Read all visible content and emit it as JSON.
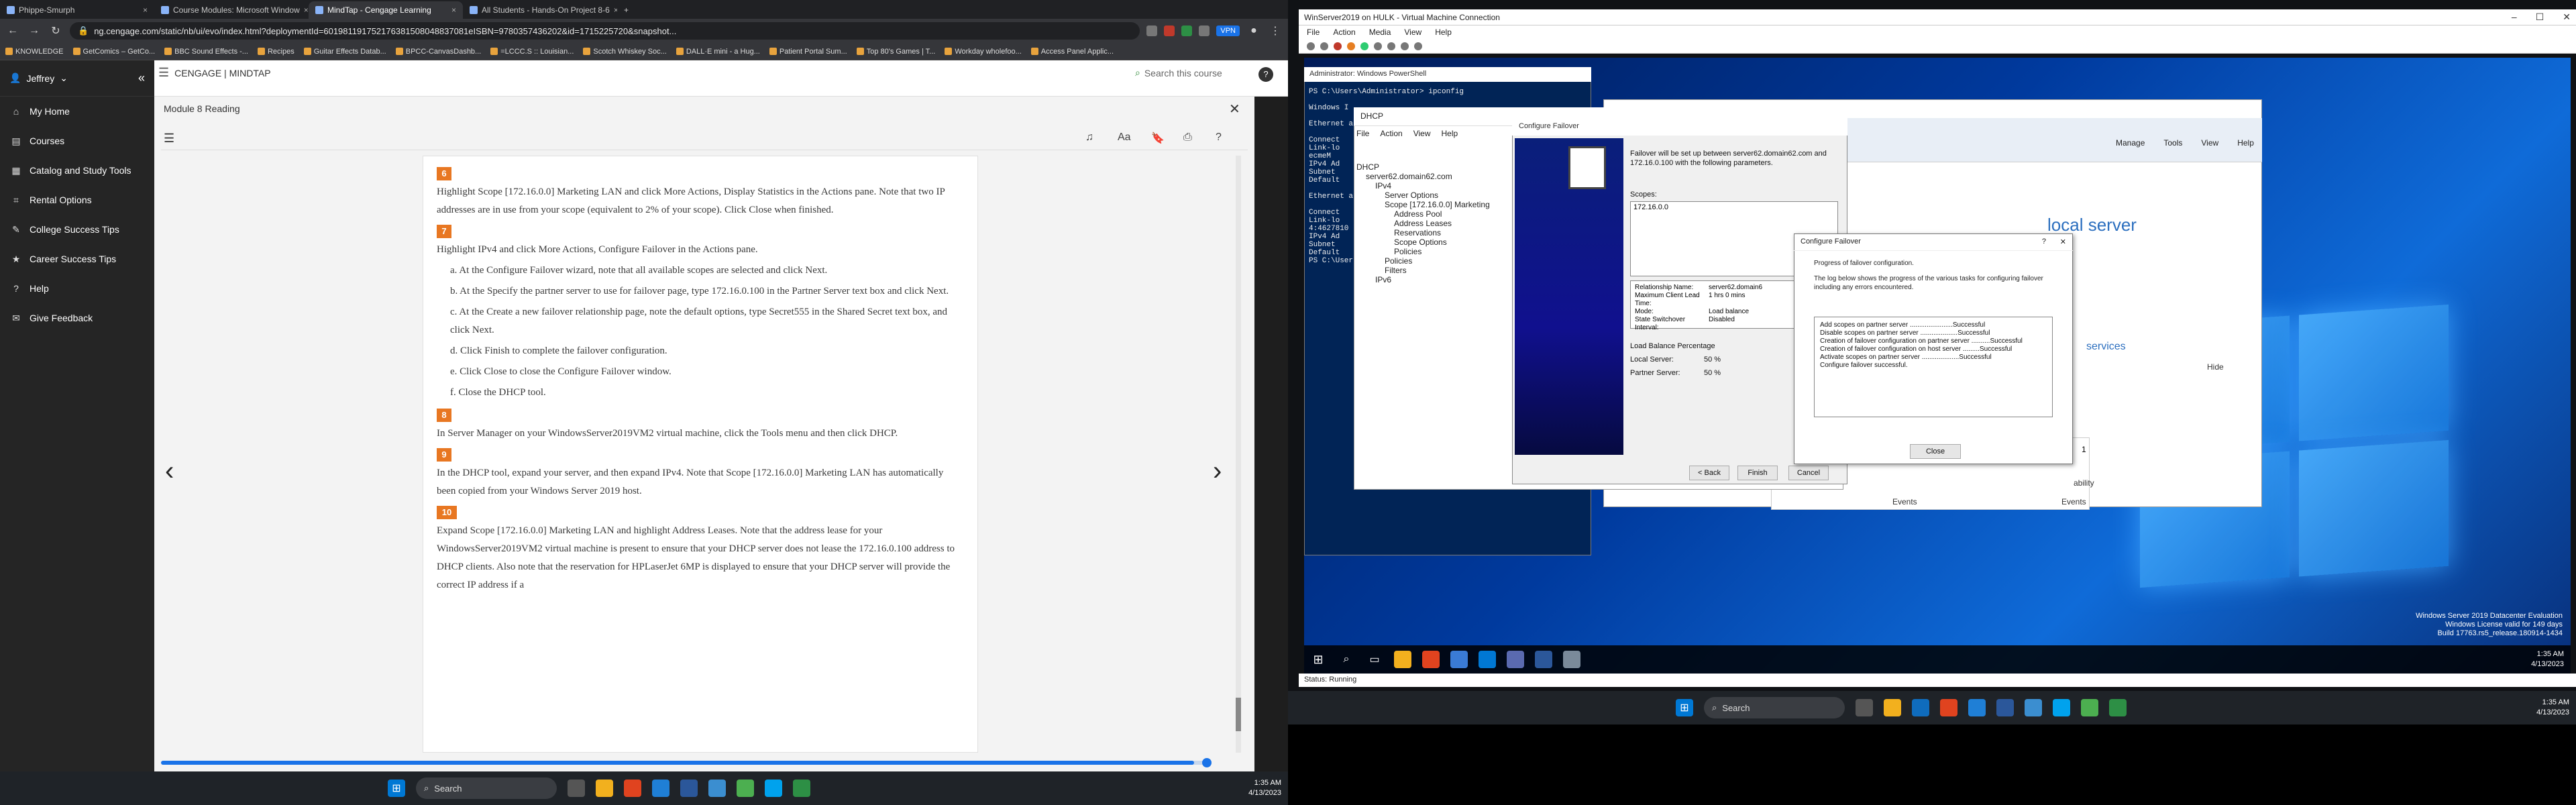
{
  "browser": {
    "tabs": [
      {
        "label": "Phippe-Smurph",
        "active": false
      },
      {
        "label": "Course Modules: Microsoft Window",
        "active": false
      },
      {
        "label": "MindTap - Cengage Learning",
        "active": true
      },
      {
        "label": "All Students - Hands-On Project 8-6",
        "active": false
      }
    ],
    "url": "ng.cengage.com/static/nb/ui/evo/index.html?deploymentId=601981191752176381508048837081eISBN=9780357436202&id=1715225720&snapshot...",
    "vpn_label": "VPN",
    "bookmarks": [
      "KNOWLEDGE",
      "GetComics – GetCo...",
      "BBC Sound Effects -...",
      "Recipes",
      "Guitar Effects Datab...",
      "BPCC-CanvasDashb...",
      "=LCCC.S :: Louisian...",
      "Scotch Whiskey Soc...",
      "DALL·E mini - a Hug...",
      "Patient Portal Sum...",
      "Top 80's Games | T...",
      "Workday wholefoo...",
      "Access Panel Applic..."
    ]
  },
  "mindtap": {
    "brand": "CENGAGE | MINDTAP",
    "search_placeholder": "Search this course",
    "user": "Jeffrey",
    "nav": [
      {
        "label": "My Home",
        "icon": "home-icon"
      },
      {
        "label": "Courses",
        "icon": "courses-icon"
      },
      {
        "label": "Catalog and Study Tools",
        "icon": "catalog-icon"
      },
      {
        "label": "Rental Options",
        "icon": "rental-icon"
      },
      {
        "label": "College Success Tips",
        "icon": "tips-icon"
      },
      {
        "label": "Career Success Tips",
        "icon": "career-icon"
      },
      {
        "label": "Help",
        "icon": "help-icon"
      },
      {
        "label": "Give Feedback",
        "icon": "feedback-icon"
      }
    ],
    "module_title": "Module 8 Reading",
    "reading_progress": 0.99,
    "content": {
      "step6_num": "6",
      "step6_text": "Highlight Scope [172.16.0.0] Marketing LAN and click More Actions, Display Statistics in the Actions pane. Note that two IP addresses are in use from your scope (equivalent to 2% of your scope). Click Close when finished.",
      "step7_num": "7",
      "step7_text": "Highlight IPv4 and click More Actions, Configure Failover in the Actions pane.",
      "step7_a": "a. At the Configure Failover wizard, note that all available scopes are selected and click Next.",
      "step7_b": "b. At the Specify the partner server to use for failover page, type 172.16.0.100 in the Partner Server text box and click Next.",
      "step7_c": "c. At the Create a new failover relationship page, note the default options, type Secret555 in the Shared Secret text box, and click Next.",
      "step7_d": "d. Click Finish to complete the failover configuration.",
      "step7_e": "e. Click Close to close the Configure Failover window.",
      "step7_f": "f. Close the DHCP tool.",
      "step8_num": "8",
      "step8_text": "In Server Manager on your WindowsServer2019VM2 virtual machine, click the Tools menu and then click DHCP.",
      "step9_num": "9",
      "step9_text": "In the DHCP tool, expand your server, and then expand IPv4. Note that Scope [172.16.0.0] Marketing LAN has automatically been copied from your Windows Server 2019 host.",
      "step10_num": "10",
      "step10_text": "Expand Scope [172.16.0.0] Marketing LAN and highlight Address Leases. Note that the address lease for your WindowsServer2019VM2 virtual machine is present to ensure that your DHCP server does not lease the 172.16.0.100 address to DHCP clients. Also note that the reservation for HPLaserJet 6MP is displayed to ensure that your DHCP server will provide the correct IP address if a"
    }
  },
  "left_taskbar": {
    "search": "Search",
    "time": "1:35 AM",
    "date": "4/13/2023"
  },
  "vm": {
    "window_title": "WinServer2019 on HULK - Virtual Machine Connection",
    "menu": [
      "File",
      "Action",
      "Media",
      "View",
      "Help"
    ],
    "powershell": {
      "title": "Administrator: Windows PowerShell",
      "lines": [
        "PS C:\\Users\\Administrator> ipconfig",
        "",
        "Windows I",
        "",
        "Ethernet a",
        "",
        "   Connect",
        "   Link-lo",
        "ecmeM",
        "   IPv4 Ad",
        "   Subnet",
        "   Default",
        "",
        "Ethernet a",
        "",
        "   Connect",
        "   Link-lo",
        "4:4627810",
        "   IPv4 Ad",
        "   Subnet",
        "   Default",
        "PS C:\\Users"
      ]
    },
    "server_manager": {
      "menu": [
        "Manage",
        "Tools",
        "View",
        "Help"
      ],
      "local_server": "local server",
      "services": "services",
      "hide": "Hide",
      "tile_count": "1",
      "events": "Events",
      "ability": "ability"
    },
    "dhcp": {
      "title": "DHCP",
      "menu": [
        "File",
        "Action",
        "View",
        "Help"
      ],
      "tree": [
        {
          "label": "DHCP",
          "indent": 0
        },
        {
          "label": "server62.domain62.com",
          "indent": 1
        },
        {
          "label": "IPv4",
          "indent": 2
        },
        {
          "label": "Server Options",
          "indent": 3
        },
        {
          "label": "Scope [172.16.0.0] Marketing",
          "indent": 3
        },
        {
          "label": "Address Pool",
          "indent": 4
        },
        {
          "label": "Address Leases",
          "indent": 4
        },
        {
          "label": "Reservations",
          "indent": 4
        },
        {
          "label": "Scope Options",
          "indent": 4
        },
        {
          "label": "Policies",
          "indent": 4
        },
        {
          "label": "Policies",
          "indent": 3
        },
        {
          "label": "Filters",
          "indent": 3
        },
        {
          "label": "IPv6",
          "indent": 2
        }
      ]
    },
    "failover_wizard": {
      "title": "Configure Failover",
      "intro": "Failover will be set up between server62.domain62.com and 172.16.0.100 with the following parameters.",
      "scopes_label": "Scopes:",
      "scope_value": "172.16.0.0",
      "params": [
        {
          "k": "Relationship Name:",
          "v": "server62.domain6"
        },
        {
          "k": "Maximum Client Lead Time:",
          "v": "1 hrs 0 mins"
        },
        {
          "k": "Mode:",
          "v": "Load balance"
        },
        {
          "k": "State Switchover Interval:",
          "v": "Disabled"
        }
      ],
      "lb_label": "Load Balance Percentage",
      "local_server_label": "Local Server:",
      "local_server_value": "50 %",
      "partner_server_label": "Partner Server:",
      "partner_server_value": "50 %",
      "back": "< Back",
      "finish": "Finish",
      "cancel": "Cancel"
    },
    "failover_progress": {
      "title": "Configure Failover",
      "intro1": "Progress of failover configuration.",
      "intro2": "The log below shows the progress of the various tasks for configuring failover including any errors encountered.",
      "log": [
        "Add scopes on partner server .......................Successful",
        "Disable scopes on partner server ....................Successful",
        "Creation of failover configuration on partner server ..........Successful",
        "Creation of failover configuration on host server .........Successful",
        "Activate scopes on partner server ....................Successful",
        "Configure failover successful."
      ],
      "close": "Close"
    },
    "watermark": [
      "Windows Server 2019 Datacenter Evaluation",
      "Windows License valid for 149 days",
      "Build 17763.rs5_release.180914-1434"
    ],
    "vm_time": "1:35 AM",
    "vm_date": "4/13/2023",
    "status": "Status: Running"
  },
  "right_taskbar": {
    "search": "Search",
    "time": "1:35 AM",
    "date": "4/13/2023"
  }
}
